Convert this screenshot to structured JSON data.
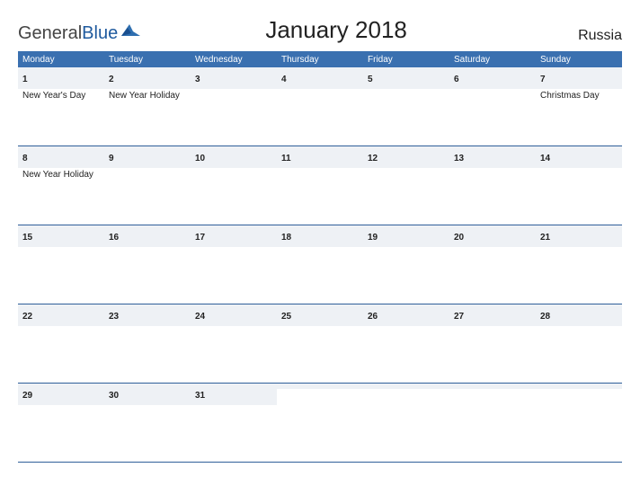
{
  "brand": {
    "part1": "General",
    "part2": "Blue"
  },
  "title": "January 2018",
  "country": "Russia",
  "weekdays": [
    "Monday",
    "Tuesday",
    "Wednesday",
    "Thursday",
    "Friday",
    "Saturday",
    "Sunday"
  ],
  "weeks": [
    [
      {
        "num": "1",
        "event": "New Year's Day"
      },
      {
        "num": "2",
        "event": "New Year Holiday"
      },
      {
        "num": "3",
        "event": ""
      },
      {
        "num": "4",
        "event": ""
      },
      {
        "num": "5",
        "event": ""
      },
      {
        "num": "6",
        "event": ""
      },
      {
        "num": "7",
        "event": "Christmas Day"
      }
    ],
    [
      {
        "num": "8",
        "event": "New Year Holiday"
      },
      {
        "num": "9",
        "event": ""
      },
      {
        "num": "10",
        "event": ""
      },
      {
        "num": "11",
        "event": ""
      },
      {
        "num": "12",
        "event": ""
      },
      {
        "num": "13",
        "event": ""
      },
      {
        "num": "14",
        "event": ""
      }
    ],
    [
      {
        "num": "15",
        "event": ""
      },
      {
        "num": "16",
        "event": ""
      },
      {
        "num": "17",
        "event": ""
      },
      {
        "num": "18",
        "event": ""
      },
      {
        "num": "19",
        "event": ""
      },
      {
        "num": "20",
        "event": ""
      },
      {
        "num": "21",
        "event": ""
      }
    ],
    [
      {
        "num": "22",
        "event": ""
      },
      {
        "num": "23",
        "event": ""
      },
      {
        "num": "24",
        "event": ""
      },
      {
        "num": "25",
        "event": ""
      },
      {
        "num": "26",
        "event": ""
      },
      {
        "num": "27",
        "event": ""
      },
      {
        "num": "28",
        "event": ""
      }
    ],
    [
      {
        "num": "29",
        "event": ""
      },
      {
        "num": "30",
        "event": ""
      },
      {
        "num": "31",
        "event": ""
      },
      {
        "num": "",
        "event": ""
      },
      {
        "num": "",
        "event": ""
      },
      {
        "num": "",
        "event": ""
      },
      {
        "num": "",
        "event": ""
      }
    ]
  ]
}
